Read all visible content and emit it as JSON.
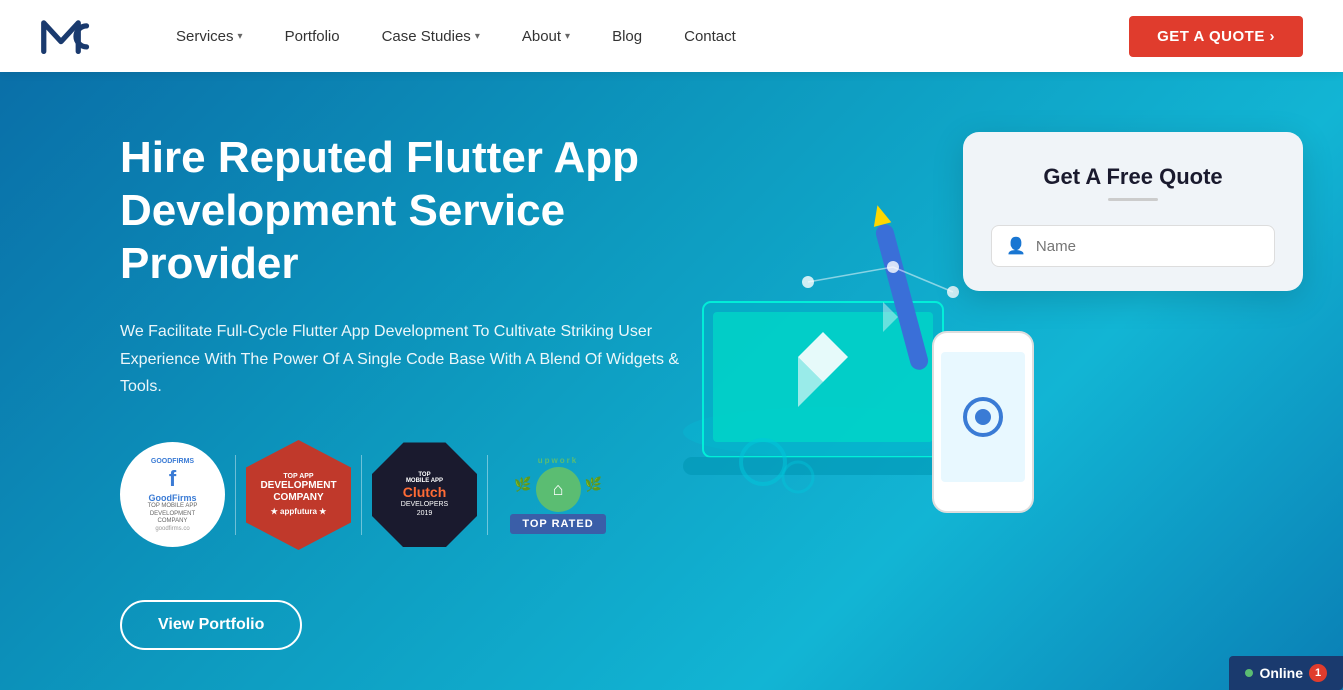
{
  "navbar": {
    "logo_text": "MC",
    "nav_items": [
      {
        "label": "Services",
        "has_dropdown": true
      },
      {
        "label": "Portfolio",
        "has_dropdown": false
      },
      {
        "label": "Case Studies",
        "has_dropdown": true
      },
      {
        "label": "About",
        "has_dropdown": true
      },
      {
        "label": "Blog",
        "has_dropdown": false
      },
      {
        "label": "Contact",
        "has_dropdown": false
      }
    ],
    "cta_label": "GET A QUOTE  ›"
  },
  "hero": {
    "title": "Hire Reputed Flutter App Development Service Provider",
    "subtitle": "We Facilitate Full-Cycle Flutter App Development To Cultivate Striking User Experience With The Power Of A Single Code Base With A Blend Of Widgets & Tools.",
    "cta_button": "View Portfolio",
    "quote_card": {
      "title": "Get A Free Quote",
      "name_placeholder": "Name"
    },
    "badges": [
      {
        "name": "GoodFirms",
        "sub": "TOP MOBILE APP DEVELOPMENT COMPANY"
      },
      {
        "name": "AppFutura",
        "sub": "TOP APP DEVELOPMENT COMPANY"
      },
      {
        "name": "Clutch",
        "sub": "TOP MOBILE APP DEVELOPERS 2019"
      },
      {
        "name": "Upwork",
        "sub": "TOP RATED"
      }
    ]
  },
  "online_indicator": {
    "label": "Online",
    "count": "1"
  }
}
